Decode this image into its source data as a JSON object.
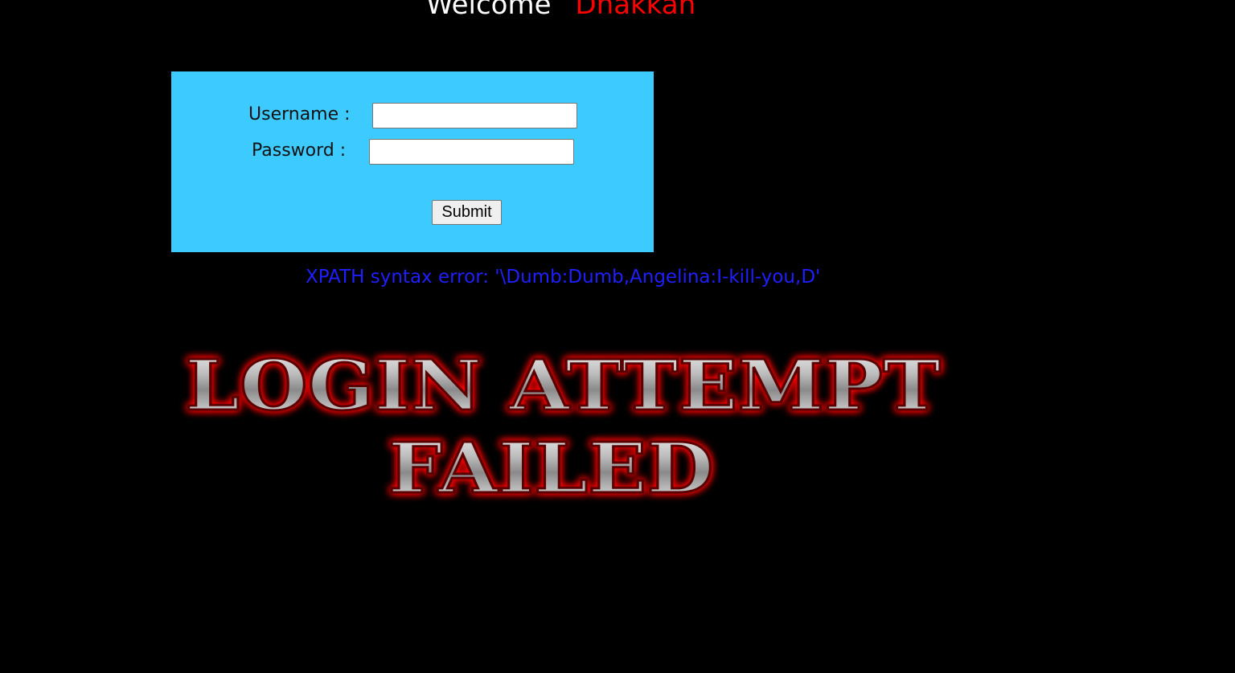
{
  "header": {
    "welcome_word": "Welcome",
    "welcome_name": "Dhakkan"
  },
  "login_form": {
    "username_label": "Username :",
    "password_label": "Password :",
    "username_value": "",
    "password_value": "",
    "submit_label": "Submit"
  },
  "error": {
    "message": "XPATH syntax error: '\\Dumb:Dumb,Angelina:I-kill-you,D'"
  },
  "banner": {
    "line1": "LOGIN ATTEMPT",
    "line2": "FAILED"
  },
  "colors": {
    "background": "#000000",
    "form_background": "#3ccaff",
    "welcome_name": "#ff0000",
    "error_text": "#1f1fff",
    "banner_glow": "#ff0000"
  }
}
